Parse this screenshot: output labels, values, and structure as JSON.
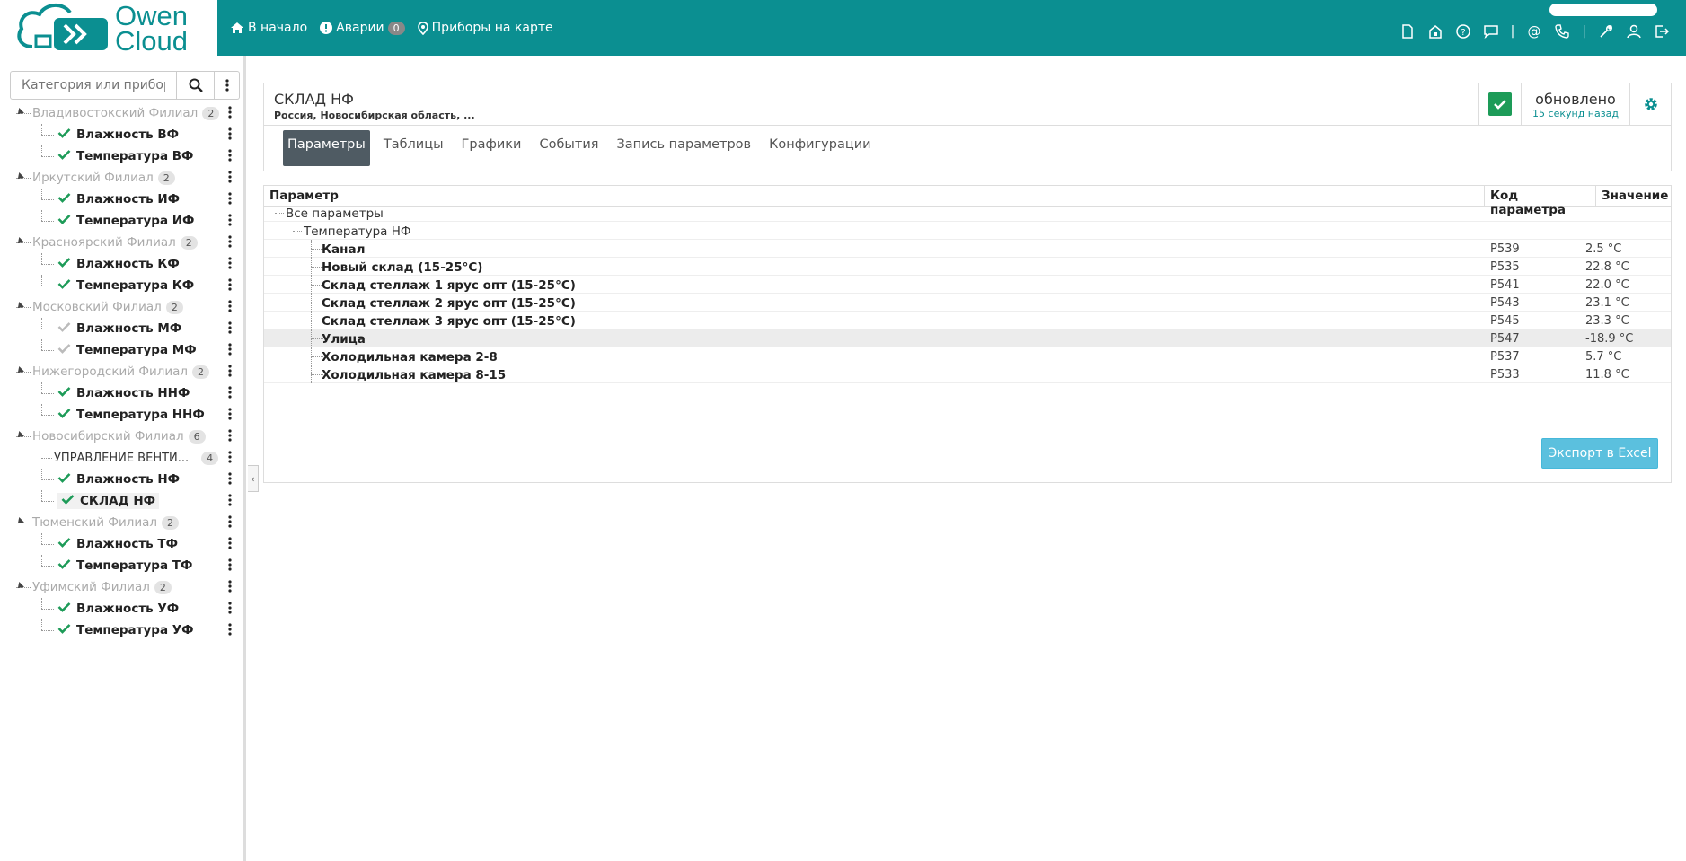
{
  "brand": {
    "line1": "Owen",
    "line2": "Cloud",
    "color": "#0b8f91"
  },
  "nav": {
    "home": "В начало",
    "alarms": "Аварии",
    "alarms_count": "0",
    "map": "Приборы на карте"
  },
  "toolbar_icons": [
    "file-icon",
    "lock-house-icon",
    "help-icon",
    "chat-icon",
    "at-icon",
    "phone-icon",
    "wrench-icon",
    "user-icon",
    "logout-icon"
  ],
  "sidebar": {
    "search_placeholder": "Категория или прибор...",
    "groups": [
      {
        "name": "Владивостокский Филиал",
        "count": "2",
        "items": [
          {
            "name": "Влажность ВФ",
            "ok": true
          },
          {
            "name": "Температура ВФ",
            "ok": true
          }
        ]
      },
      {
        "name": "Иркутский Филиал",
        "count": "2",
        "items": [
          {
            "name": "Влажность ИФ",
            "ok": true
          },
          {
            "name": "Температура ИФ",
            "ok": true
          }
        ]
      },
      {
        "name": "Красноярский Филиал",
        "count": "2",
        "items": [
          {
            "name": "Влажность КФ",
            "ok": true
          },
          {
            "name": "Температура КФ",
            "ok": true
          }
        ]
      },
      {
        "name": "Московский Филиал",
        "count": "2",
        "items": [
          {
            "name": "Влажность МФ",
            "ok": false
          },
          {
            "name": "Температура МФ",
            "ok": false
          }
        ]
      },
      {
        "name": "Нижегородский Филиал",
        "count": "2",
        "items": [
          {
            "name": "Влажность ННФ",
            "ok": true
          },
          {
            "name": "Температура ННФ",
            "ok": true
          }
        ]
      },
      {
        "name": "Новосибирский Филиал",
        "count": "6",
        "sub": {
          "name": "УПРАВЛЕНИЕ ВЕНТИ...",
          "count": "4"
        },
        "items": [
          {
            "name": "Влажность НФ",
            "ok": true
          },
          {
            "name": "СКЛАД НФ",
            "ok": true,
            "selected": true
          }
        ]
      },
      {
        "name": "Тюменский Филиал",
        "count": "2",
        "items": [
          {
            "name": "Влажность ТФ",
            "ok": true
          },
          {
            "name": "Температура ТФ",
            "ok": true
          }
        ]
      },
      {
        "name": "Уфимский Филиал",
        "count": "2",
        "items": [
          {
            "name": "Влажность УФ",
            "ok": true
          },
          {
            "name": "Температура УФ",
            "ok": true
          }
        ]
      }
    ]
  },
  "device": {
    "title": "СКЛАД НФ",
    "address": "Россия, Новосибирская область, ...",
    "status_updated": "обновлено",
    "status_ago": "15 секунд назад"
  },
  "tabs": [
    "Параметры",
    "Таблицы",
    "Графики",
    "События",
    "Запись параметров",
    "Конфигурации"
  ],
  "active_tab": "Параметры",
  "table": {
    "headers": {
      "param": "Параметр",
      "code": "Код параметра",
      "value": "Значение"
    },
    "root": "Все параметры",
    "group": "Температура НФ",
    "rows": [
      {
        "name": "Канал",
        "code": "P539",
        "value": "2.5 °C"
      },
      {
        "name": "Новый склад (15-25°C)",
        "code": "P535",
        "value": "22.8 °C"
      },
      {
        "name": "Склад стеллаж 1 ярус опт (15-25°C)",
        "code": "P541",
        "value": "22.0 °C"
      },
      {
        "name": "Склад стеллаж 2 ярус опт (15-25°C)",
        "code": "P543",
        "value": "23.1 °C"
      },
      {
        "name": "Склад стеллаж 3 ярус опт (15-25°C)",
        "code": "P545",
        "value": "23.3 °C"
      },
      {
        "name": "Улица",
        "code": "P547",
        "value": "-18.9 °C",
        "highlight": true
      },
      {
        "name": "Холодильная камера 2-8",
        "code": "P537",
        "value": "5.7 °C"
      },
      {
        "name": "Холодильная камера 8-15",
        "code": "P533",
        "value": "11.8 °C"
      }
    ],
    "export_label": "Экспорт в Excel"
  }
}
